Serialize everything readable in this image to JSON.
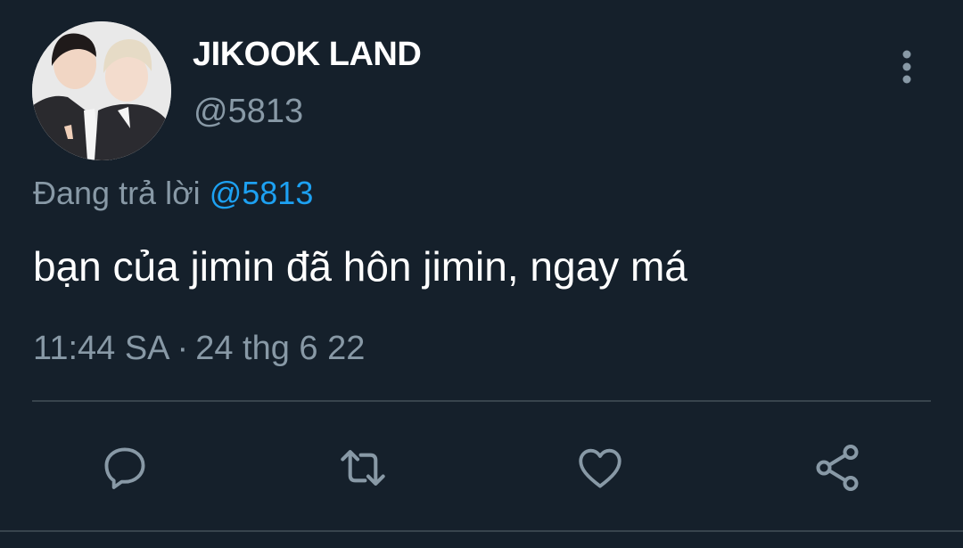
{
  "user": {
    "display_name": "JIKOOK LAND",
    "handle": "@5813",
    "avatar_icon": "profile-photo"
  },
  "reply": {
    "prefix": "Đang trả lời",
    "mention": "@5813"
  },
  "tweet": {
    "text": "bạn của jimin đã hôn jimin, ngay má",
    "time": "11:44 SA",
    "separator": "·",
    "date": "24 thg 6 22"
  },
  "actions": {
    "reply_icon": "comment-icon",
    "retweet_icon": "retweet-icon",
    "like_icon": "heart-icon",
    "share_icon": "share-icon",
    "more_icon": "more-vertical-icon"
  },
  "colors": {
    "background": "#15202b",
    "text": "#ffffff",
    "secondary_text": "#8899a6",
    "link": "#1da1f2",
    "divider": "#38444d"
  }
}
